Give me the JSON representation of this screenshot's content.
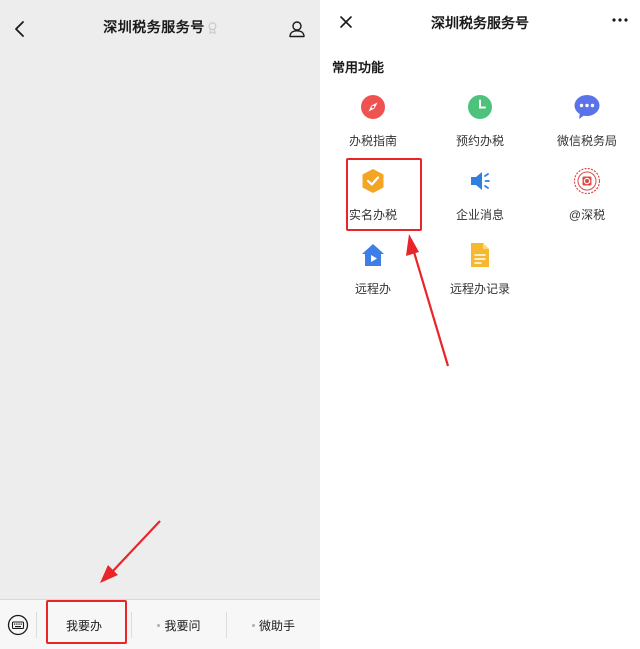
{
  "left": {
    "title": "深圳税务服务号",
    "menu": {
      "item1": "我要办",
      "item2": "我要问",
      "item3": "微助手"
    }
  },
  "right": {
    "title": "深圳税务服务号",
    "section_title": "常用功能",
    "functions": [
      {
        "label": "办税指南",
        "icon": "compass-icon",
        "color": "#ef5350"
      },
      {
        "label": "预约办税",
        "icon": "clock-icon",
        "color": "#4cc27a"
      },
      {
        "label": "微信税务局",
        "icon": "chat-bubble-icon",
        "color": "#5b73e8"
      },
      {
        "label": "实名办税",
        "icon": "shield-check-icon",
        "color": "#f5a524"
      },
      {
        "label": "企业消息",
        "icon": "speaker-icon",
        "color": "#2f7fe0"
      },
      {
        "label": "@深税",
        "icon": "seal-logo-icon",
        "color": "#e04848"
      },
      {
        "label": "远程办",
        "icon": "house-play-icon",
        "color": "#3d7ee8"
      },
      {
        "label": "远程办记录",
        "icon": "document-icon",
        "color": "#f5b82e"
      }
    ]
  },
  "colors": {
    "highlight": "#e8262a",
    "left_bg": "#ededed"
  }
}
